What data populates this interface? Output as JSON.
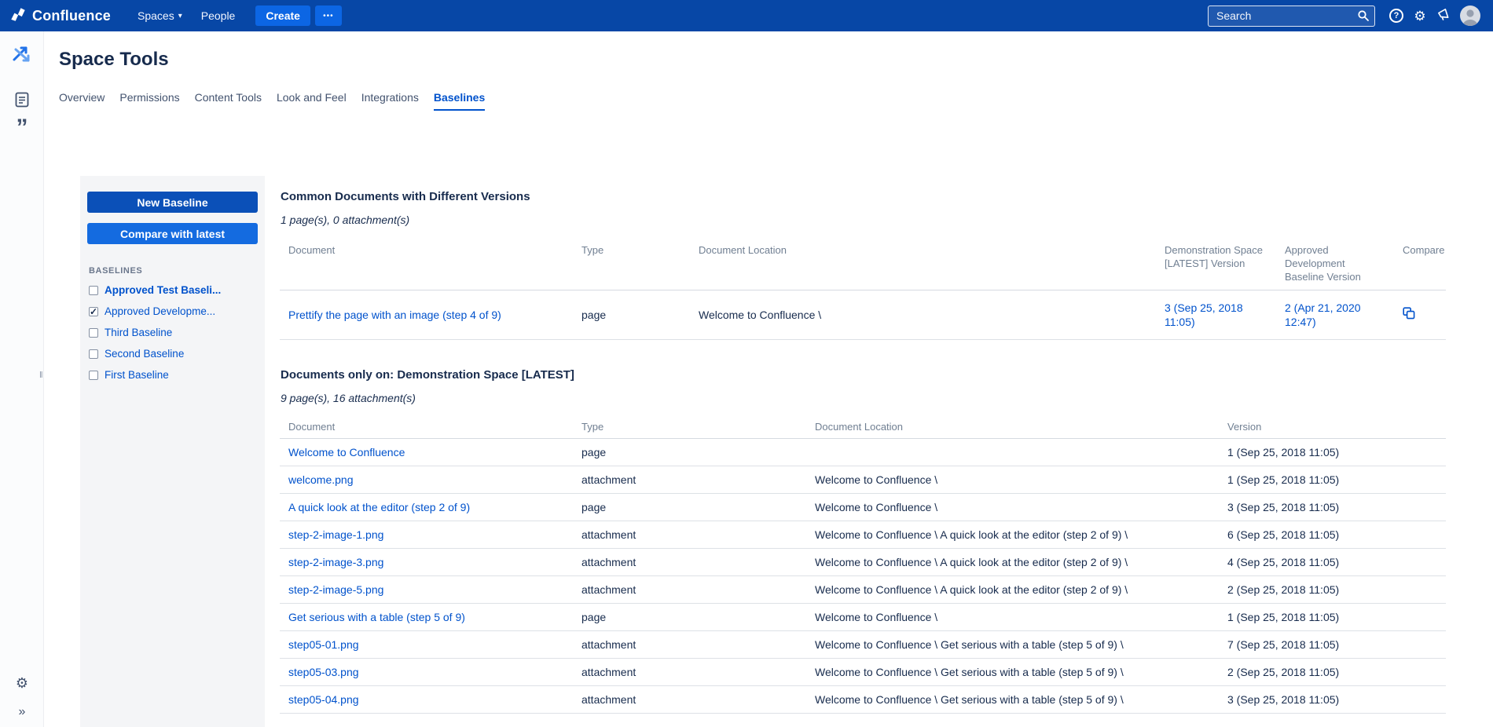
{
  "topnav": {
    "brand": "Confluence",
    "items": [
      {
        "label": "Spaces",
        "has_chevron": true
      },
      {
        "label": "People",
        "has_chevron": false
      }
    ],
    "create_label": "Create",
    "search": {
      "placeholder": "Search"
    }
  },
  "icons": {
    "spaces_chevron": "▾",
    "more": "•••",
    "help": "?",
    "settings": "⚙",
    "blog_quote": "”",
    "sidebar_settings": "⚙",
    "expand": "»",
    "grip": "‖"
  },
  "page": {
    "title": "Space Tools",
    "tabs": [
      {
        "label": "Overview",
        "active": false
      },
      {
        "label": "Permissions",
        "active": false
      },
      {
        "label": "Content Tools",
        "active": false
      },
      {
        "label": "Look and Feel",
        "active": false
      },
      {
        "label": "Integrations",
        "active": false
      },
      {
        "label": "Baselines",
        "active": true
      }
    ]
  },
  "baseline_panel": {
    "new_baseline_label": "New Baseline",
    "compare_label": "Compare with latest",
    "list_title": "BASELINES",
    "items": [
      {
        "label": "Approved Test Baseli...",
        "checked": false,
        "bold": true
      },
      {
        "label": "Approved Developme...",
        "checked": true,
        "bold": false
      },
      {
        "label": "Third Baseline",
        "checked": false,
        "bold": false
      },
      {
        "label": "Second Baseline",
        "checked": false,
        "bold": false
      },
      {
        "label": "First Baseline",
        "checked": false,
        "bold": false
      }
    ]
  },
  "colors": {
    "nav_bg": "#0747A6",
    "link_blue": "#0052CC",
    "text_dark": "#172B4D",
    "panel_bg": "#F4F5F7"
  },
  "common_section": {
    "title": "Common Documents with Different Versions",
    "count": "1 page(s), 0 attachment(s)",
    "headers": {
      "document": "Document",
      "type": "Type",
      "location": "Document Location",
      "latest_version": "Demonstration Space [LATEST] Version",
      "baseline_version": "Approved Development Baseline Version",
      "compare": "Compare"
    },
    "rows": [
      {
        "document": "Prettify the page with an image (step 4 of 9)",
        "type": "page",
        "location": "Welcome to Confluence \\",
        "latest_version": "3 (Sep 25, 2018 11:05)",
        "baseline_version": "2 (Apr 21, 2020 12:47)"
      }
    ]
  },
  "only_section": {
    "title": "Documents only on: Demonstration Space [LATEST]",
    "count": "9 page(s), 16 attachment(s)",
    "headers": {
      "document": "Document",
      "type": "Type",
      "location": "Document Location",
      "version": "Version"
    },
    "rows": [
      {
        "document": "Welcome to Confluence",
        "type": "page",
        "location": "",
        "version": "1 (Sep 25, 2018 11:05)"
      },
      {
        "document": "welcome.png",
        "type": "attachment",
        "location": "Welcome to Confluence \\",
        "version": "1 (Sep 25, 2018 11:05)"
      },
      {
        "document": "A quick look at the editor (step 2 of 9)",
        "type": "page",
        "location": "Welcome to Confluence \\",
        "version": "3 (Sep 25, 2018 11:05)"
      },
      {
        "document": "step-2-image-1.png",
        "type": "attachment",
        "location": "Welcome to Confluence \\ A quick look at the editor (step 2 of 9) \\",
        "version": "6 (Sep 25, 2018 11:05)"
      },
      {
        "document": "step-2-image-3.png",
        "type": "attachment",
        "location": "Welcome to Confluence \\ A quick look at the editor (step 2 of 9) \\",
        "version": "4 (Sep 25, 2018 11:05)"
      },
      {
        "document": "step-2-image-5.png",
        "type": "attachment",
        "location": "Welcome to Confluence \\ A quick look at the editor (step 2 of 9) \\",
        "version": "2 (Sep 25, 2018 11:05)"
      },
      {
        "document": "Get serious with a table (step 5 of 9)",
        "type": "page",
        "location": "Welcome to Confluence \\",
        "version": "1 (Sep 25, 2018 11:05)"
      },
      {
        "document": "step05-01.png",
        "type": "attachment",
        "location": "Welcome to Confluence \\ Get serious with a table (step 5 of 9) \\",
        "version": "7 (Sep 25, 2018 11:05)"
      },
      {
        "document": "step05-03.png",
        "type": "attachment",
        "location": "Welcome to Confluence \\ Get serious with a table (step 5 of 9) \\",
        "version": "2 (Sep 25, 2018 11:05)"
      },
      {
        "document": "step05-04.png",
        "type": "attachment",
        "location": "Welcome to Confluence \\ Get serious with a table (step 5 of 9) \\",
        "version": "3 (Sep 25, 2018 11:05)"
      }
    ]
  }
}
